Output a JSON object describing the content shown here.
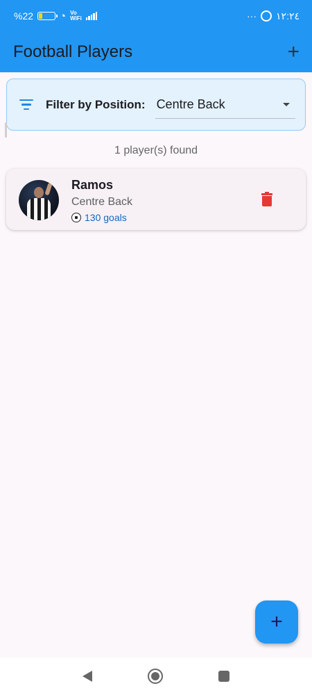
{
  "status_bar": {
    "battery_text": "%22",
    "wifi_text": "Vo\nWiFi",
    "more_text": "···",
    "time": "١٢:٢٤"
  },
  "app_bar": {
    "title": "Football Players",
    "add_icon": "plus-icon"
  },
  "filter": {
    "icon": "filter-icon",
    "label": "Filter by Position:",
    "selected": "Centre Back"
  },
  "results": {
    "count_text": "1 player(s) found"
  },
  "players": [
    {
      "name": "Ramos",
      "position": "Centre Back",
      "goals_text": "130 goals",
      "delete_icon": "trash-icon"
    }
  ],
  "fab": {
    "label": "+"
  },
  "colors": {
    "primary": "#2196f3",
    "filter_bg": "#e3f2fd",
    "delete": "#e53935",
    "goals_text": "#1565c0"
  }
}
